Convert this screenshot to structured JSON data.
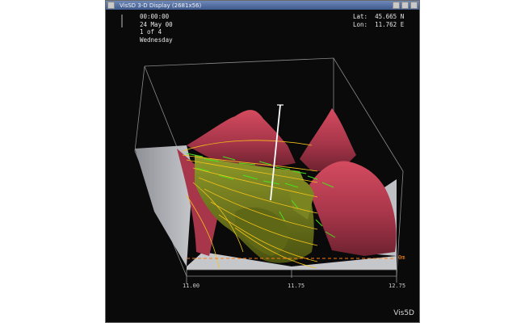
{
  "window": {
    "title": "VisSD 3-D Display (2681x56)"
  },
  "hud": {
    "time": "00:00:00",
    "date": "24 May 00",
    "frame": "1 of 4",
    "weekday": "Wednesday",
    "lat_label": "Lat:",
    "lat_value": "45.665 N",
    "lon_label": "Lon:",
    "lon_value": "11.762 E"
  },
  "axes": {
    "x_ticks": [
      "11.00",
      "11.75",
      "12.75"
    ],
    "z_tick": "0m"
  },
  "brand": "Vis5D",
  "colors": {
    "terrain_high": "#c94255",
    "terrain_low": "#6f7a1e",
    "contours": "#f4c21a",
    "wind": "#3fe01a",
    "slice": "#ff7a10"
  }
}
